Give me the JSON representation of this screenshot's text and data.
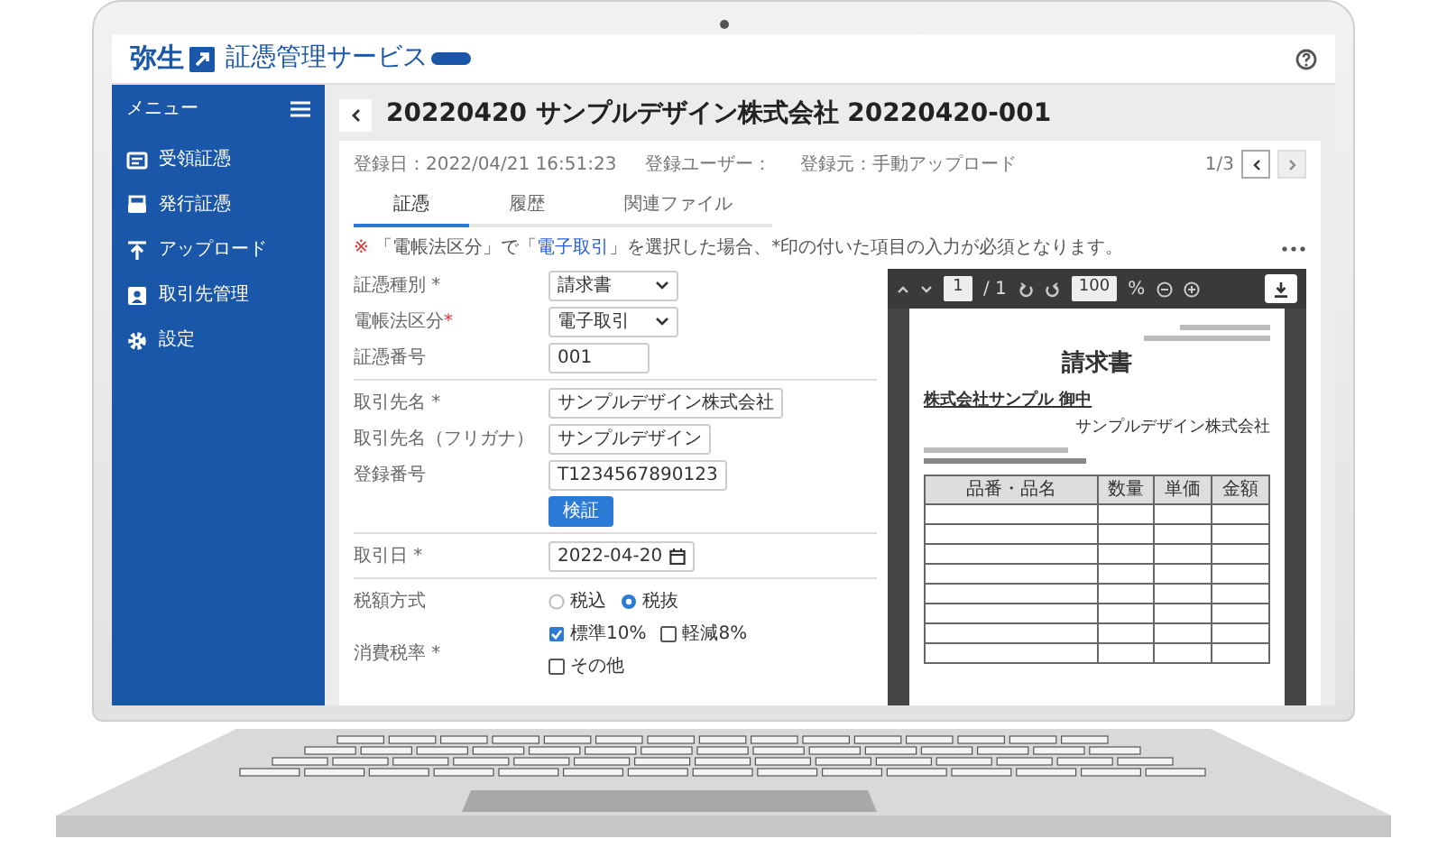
{
  "header": {
    "brand": "弥生",
    "service": "証憑管理サービス"
  },
  "sidebar": {
    "title": "メニュー",
    "items": [
      {
        "label": "受領証憑"
      },
      {
        "label": "発行証憑"
      },
      {
        "label": "アップロード"
      },
      {
        "label": "取引先管理"
      },
      {
        "label": "設定"
      }
    ]
  },
  "page": {
    "title": "20220420 サンプルデザイン株式会社 20220420-001"
  },
  "meta": [
    "登録日：2022/04/21 16:51:23",
    "登録ユーザー：",
    "登録元：手動アップロード"
  ],
  "pager": "1/3",
  "tabs": [
    {
      "label": "証憑",
      "selected": true
    },
    {
      "label": "履歴",
      "selected": false
    },
    {
      "label": "関連ファイル",
      "selected": false
    }
  ],
  "notice": {
    "mark": "※",
    "before": "「電帳法区分」で「",
    "link": "電子取引",
    "after": "」を選択した場合、*印の付いた項目の入力が必須となります。"
  },
  "form": [
    {
      "fields": [
        {
          "kind": "select",
          "label": "証憑種別 *",
          "value": "請求書"
        },
        {
          "kind": "select",
          "label": "電帳法区分",
          "mark": "*",
          "value": "電子取引"
        },
        {
          "kind": "text",
          "label": "証憑番号",
          "value": "001"
        }
      ]
    },
    {
      "fields": [
        {
          "kind": "text",
          "label": "取引先名 *",
          "value": "サンプルデザイン株式会社"
        },
        {
          "kind": "text",
          "label": "取引先名（フリガナ）",
          "value": "サンプルデザイン"
        },
        {
          "kind": "text",
          "label": "登録番号",
          "value": "T1234567890123"
        },
        {
          "kind": "button",
          "label": "検証"
        }
      ]
    },
    {
      "fields": [
        {
          "kind": "date",
          "label": "取引日 *",
          "value": "2022-04-20"
        }
      ]
    },
    {
      "fields": [
        {
          "kind": "radio",
          "label": "税額方式",
          "options": [
            {
              "label": "税込",
              "selected": false
            },
            {
              "label": "税抜",
              "selected": true
            }
          ]
        },
        {
          "kind": "checkbox",
          "label": "消費税率 *",
          "options": [
            {
              "label": "標準10%",
              "checked": true
            },
            {
              "label": "軽減8%",
              "checked": false
            },
            {
              "label": "その他",
              "checked": false
            }
          ]
        }
      ]
    }
  ],
  "viewer": {
    "page": "1",
    "pages": "/ 1",
    "zoom": "100",
    "zoom_unit": "%",
    "document": {
      "title": "請求書",
      "recipient": "株式会社サンプル 御中",
      "issuer": "サンプルデザイン株式会社",
      "columns": [
        "品番・品名",
        "数量",
        "単価",
        "金額"
      ]
    }
  }
}
